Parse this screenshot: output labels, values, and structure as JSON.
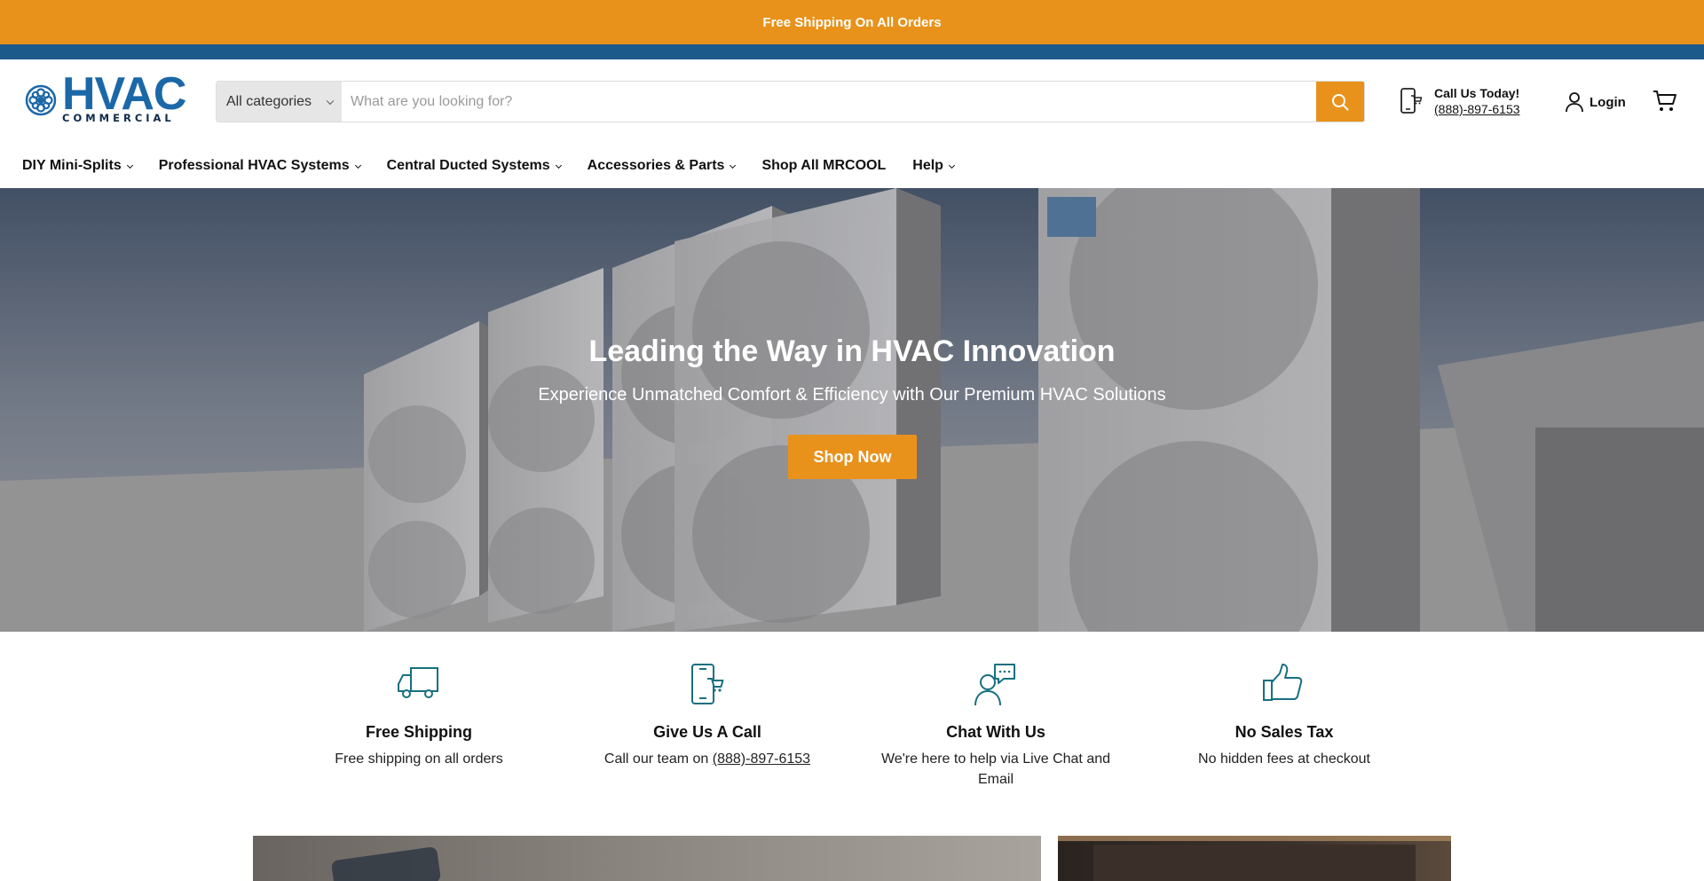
{
  "announcement": {
    "text": "Free Shipping On All Orders"
  },
  "brand": {
    "name": "HVAC",
    "tagline": "COMMERCIAL",
    "logo_icon": "fan-icon"
  },
  "search": {
    "category": "All categories",
    "placeholder": "What are you looking for?",
    "icon": "search-icon"
  },
  "contact": {
    "title": "Call Us Today!",
    "phone": "(888)-897-6153",
    "icon": "phone-icon"
  },
  "account": {
    "login_label": "Login",
    "icon": "user-icon"
  },
  "cart": {
    "icon": "cart-icon"
  },
  "nav": {
    "items": [
      {
        "label": "DIY Mini-Splits",
        "dropdown": true
      },
      {
        "label": "Professional HVAC Systems",
        "dropdown": true
      },
      {
        "label": "Central Ducted Systems",
        "dropdown": true
      },
      {
        "label": "Accessories & Parts",
        "dropdown": true
      },
      {
        "label": "Shop All MRCOOL",
        "dropdown": false
      },
      {
        "label": "Help",
        "dropdown": true
      }
    ]
  },
  "hero": {
    "title": "Leading the Way in HVAC Innovation",
    "subtitle": "Experience Unmatched Comfort & Efficiency with Our Premium HVAC Solutions",
    "cta_label": "Shop Now"
  },
  "features": [
    {
      "title": "Free Shipping",
      "text": "Free shipping on all orders",
      "icon": "truck-icon"
    },
    {
      "title": "Give Us A Call",
      "text": "Call our team on ",
      "link": "(888)-897-6153",
      "icon": "phone-cart-icon"
    },
    {
      "title": "Chat With Us",
      "text": "We're here to help via Live Chat and Email",
      "icon": "chat-support-icon"
    },
    {
      "title": "No Sales Tax",
      "text": "No hidden fees at checkout",
      "icon": "thumbs-up-icon"
    }
  ],
  "colors": {
    "accent": "#e8921b",
    "brand_blue": "#1b68a8",
    "strip_blue": "#1d5a8c",
    "icon_teal": "#17707f"
  }
}
